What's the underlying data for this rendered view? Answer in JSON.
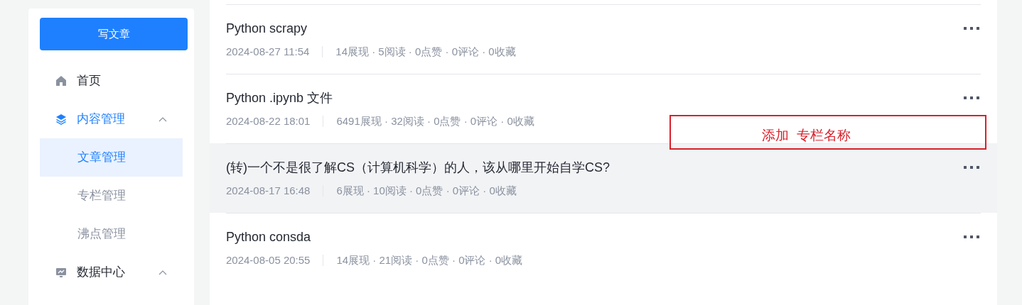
{
  "sidebar": {
    "write_button": "写文章",
    "items": [
      {
        "label": "首页"
      },
      {
        "label": "内容管理",
        "expanded": true,
        "children": [
          {
            "label": "文章管理",
            "selected": true
          },
          {
            "label": "专栏管理",
            "selected": false
          },
          {
            "label": "沸点管理",
            "selected": false
          }
        ]
      },
      {
        "label": "数据中心",
        "expanded": true
      }
    ]
  },
  "articles": [
    {
      "title": "Python scrapy",
      "date": "2024-08-27 11:54",
      "stats": "14展现 · 5阅读 · 0点赞 · 0评论 · 0收藏",
      "hovered": false
    },
    {
      "title": "Python .ipynb 文件",
      "date": "2024-08-22 18:01",
      "stats": "6491展现 · 32阅读 · 0点赞 · 0评论 · 0收藏",
      "hovered": false
    },
    {
      "title": "(转)一个不是很了解CS（计算机科学）的人，该从哪里开始自学CS?",
      "date": "2024-08-17 16:48",
      "stats": "6展现 · 10阅读 · 0点赞 · 0评论 · 0收藏",
      "hovered": true
    },
    {
      "title": "Python consda",
      "date": "2024-08-05 20:55",
      "stats": "14展现 · 21阅读 · 0点赞 · 0评论 · 0收藏",
      "hovered": false
    }
  ],
  "annotation": {
    "text": "添加  专栏名称"
  }
}
